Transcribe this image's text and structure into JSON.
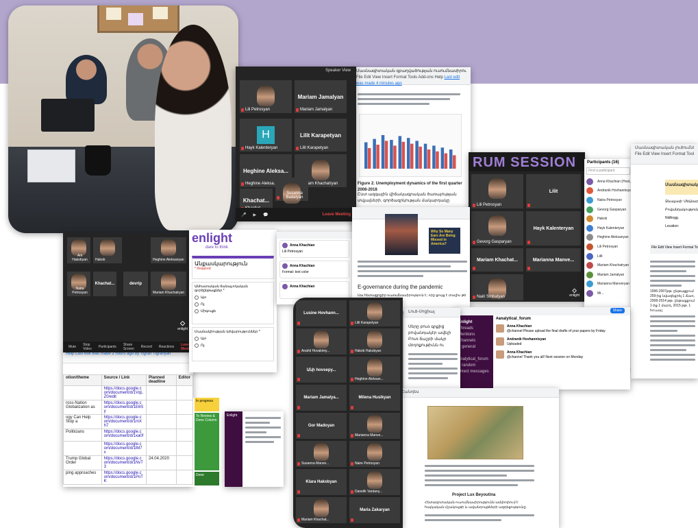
{
  "top_right_doc": {
    "title_line": "Մասնագիտական զբաղվածության ուսումնասիրություն",
    "menu": "File  Edit  View  Insert  Format  Tools  Add-ons  Help",
    "last_edit": "Last edit was made 4 minutes ago",
    "heading": "Figure 2. Unemployment dynamics of the first quarter 2008-2018",
    "body": "Ըստ ազգային վիճակագրական ծառայության տվյալների, գործազրկության մակարդակը"
  },
  "zoom_top": {
    "speaker_view": "Speaker View",
    "tiles": [
      {
        "name": "Lili Petrosyan",
        "type": "face"
      },
      {
        "name": "Mariam Jamalyan",
        "type": "name"
      },
      {
        "name": "Hayk Kalenteryan",
        "type": "letter",
        "letter": "H"
      },
      {
        "name": "Lilit Karapetyan",
        "type": "name"
      },
      {
        "name": "Heghine Aleksa...",
        "type": "name"
      },
      {
        "name": "Mariam Khachatryan",
        "type": "face"
      },
      {
        "name": "Khachat...",
        "type": "name"
      },
      {
        "name": "Susanna Badalyan",
        "type": "face"
      }
    ],
    "leave": "Leave Meeting"
  },
  "forum": {
    "title": "RUM SESSION",
    "tiles": [
      {
        "name": "Lili Petrosyan",
        "label": ""
      },
      {
        "name": "Lilit",
        "label": "Lilit"
      },
      {
        "name": "Gevorg Gasparyan",
        "label": ""
      },
      {
        "name": "Hayk Kalenteryan",
        "label": "Hayk Kalenteryan"
      },
      {
        "name": "Mariam Khachat...",
        "label": "Mariam Khachat..."
      },
      {
        "name": "Marianna Manve...",
        "label": "Marianna Manve..."
      },
      {
        "name": "Nairi Smbatyan",
        "label": ""
      }
    ],
    "brand": "enlight"
  },
  "participants": {
    "header": "Participants (16)",
    "search": "Find a participant",
    "names": [
      "Anna Khachian (Host, me)",
      "Andranik Hovhannisyan",
      "Naira Petrosyan",
      "Gevorg Gasparyan",
      "Hakob",
      "Hayk Kalenteryan",
      "Heghine Aleksanyan",
      "Lili Petrosyan",
      "Lilit",
      "Mariam Khachatryan",
      "Mariam Jamalyan",
      "Marianna Manveryan",
      "Mi..."
    ],
    "colors": [
      "#7b5aa6",
      "#e0583c",
      "#3d9cd2",
      "#46a35e",
      "#d08a2f",
      "#3d7fd2",
      "#8b8b8b",
      "#c6542f",
      "#4a66c2",
      "#c04949",
      "#5b8f3c",
      "#3d9cd2",
      "#7b5aa6"
    ]
  },
  "right_doc": {
    "title": "Մասնագիտական լուծումներ",
    "menu": "File  Edit  View  Insert  Format  Tools  Ad",
    "sub_title": "Մասնագիտական լուծումներ հայաստանում",
    "fields": [
      "Ձևաչափ: Մեկնարկ",
      "Բովանդակություն: Քննարկում",
      "Nidhogg.",
      "Location:"
    ],
    "menu2": "File  Edit  View  Insert  Format  Tools  Add-ons  Help  Last edit was made seconds ago",
    "body": "1996-2007թթ. ընթացքում 259-ից նվազեցրել 1 Ճառ, 2008-2014 թթ. ընթացքում 1-ից 1 մարդ, 2015 թթ. 1 հուսալ"
  },
  "zoom_left": {
    "tiles": [
      {
        "name": "Ani Hakobyan"
      },
      {
        "name": "Hakob"
      },
      {
        "name": "Heghine Aleksanyan"
      },
      {
        "name": "Naira Petrosyan"
      },
      {
        "name": "Khachat..."
      },
      {
        "name": "devrip"
      },
      {
        "name": "Mariam Khachatryan"
      }
    ],
    "brand": "enlight",
    "leave": "Leave Meeting",
    "toolbar": [
      "Mute",
      "Stop Video",
      "Participants",
      "Share Screen",
      "Record",
      "Reactions"
    ]
  },
  "form": {
    "brand": "enlight",
    "tagline": "dare to think",
    "title": "Անքասկարություն",
    "required": "* Required",
    "q1": "Անհատական ճանաչողական գործընթացներ *",
    "options": [
      "Այո",
      "Ոչ",
      "Միգուցե"
    ],
    "q2": "Մասնակիության դժվարություններ *",
    "options2": [
      "Այո",
      "Ոչ"
    ]
  },
  "sheet": {
    "menu_help": "Help   Last edit was made 2 hours ago by Tigran Tigranyan",
    "headers": [
      "otion/theme",
      "Source / Link",
      "Planned deadline",
      "Editor"
    ],
    "rows": [
      {
        "a": "",
        "b": "https://docs.google.com/document/d/1VqLZ0/edit",
        "c": "",
        "d": ""
      },
      {
        "a": "ross-Nation Globalization as",
        "b": "https://docs.google.com/document/d/1E6Sy",
        "c": "",
        "d": ""
      },
      {
        "a": "ogy Can Help Stop a",
        "b": "https://docs.google.com/document/d/1mXh7",
        "c": "",
        "d": ""
      },
      {
        "a": "Politicians",
        "b": "https://docs.google.com/document/d/1xa0f",
        "c": "",
        "d": ""
      },
      {
        "a": "",
        "b": "https://docs.google.com/document/d/1lM7x",
        "c": "",
        "d": ""
      },
      {
        "a": "Trump Global Order",
        "b": "https://docs.google.com/document/d/1NvT3",
        "c": "24.04.2020",
        "d": ""
      },
      {
        "a": "ping approaches",
        "b": "https://docs.google.com/document/d/1PoTK",
        "c": "",
        "d": ""
      }
    ],
    "kanban": [
      "In progress",
      "To Review & Done Column",
      "Done"
    ]
  },
  "comments": {
    "items": [
      {
        "name": "Anna Khachian",
        "text": "Lili Petrosyan"
      },
      {
        "name": "Anna Khachian",
        "text": "Format: text color"
      },
      {
        "name": "Anna Khachian",
        "text": ""
      }
    ]
  },
  "middle_doc": {
    "caption": "E-governance during the pandemic",
    "body": "Սա հետաքրքիր ուսումնասիրություն է, որը ցույց է տալիս թե ինչպես",
    "sticker": "Why So Many Ears Are Being Missed in America?"
  },
  "zoom_bottom": {
    "tiles": [
      {
        "name": "Lusine Hovhann...",
        "type": "name"
      },
      {
        "name": "Lilit Karapetyan",
        "type": "face"
      },
      {
        "name": "Anahit Hovakimy...",
        "type": "face"
      },
      {
        "name": "Hakob Hakobyan",
        "type": "face"
      },
      {
        "name": "Անի hovsepy...",
        "type": "name"
      },
      {
        "name": "Heghine Aleksan...",
        "type": "face"
      },
      {
        "name": "Mariam Jamalya...",
        "type": "name"
      },
      {
        "name": "Milena Husikyan",
        "type": "name"
      },
      {
        "name": "Gor Madoyan",
        "type": "name"
      },
      {
        "name": "Marianna Manve...",
        "type": "face"
      },
      {
        "name": "Susanna Manve...",
        "type": "face"
      },
      {
        "name": "Naire Petrosyan",
        "type": "face"
      },
      {
        "name": "",
        "type": "name",
        "label": "Klara Hakobyan"
      },
      {
        "name": "Danelik Vardany...",
        "type": "face"
      },
      {
        "name": "Mariam Khachat...",
        "type": "face"
      },
      {
        "name": "",
        "type": "name",
        "label": "Maria Zakaryan"
      }
    ]
  },
  "bottom_doc": {
    "title": "Հանդես",
    "heading": "Project Lux Beyoutina",
    "body": "Հետազոտական ուսումնասիրությունն ամփոփում է հայկական մշակույթի և ավանդույթների ազդեցությունը"
  },
  "small_doc": {
    "title": "Լուծ-Սոցիալ",
    "text_lines": [
      "Սերը բուռ գրքից",
      "բովանդակէր ավելի",
      "Բուռ ճաշբի մակր",
      "մօդոքութիւնն ու"
    ]
  },
  "slack": {
    "workspace": "Enlight",
    "channel": "#analytical_forum",
    "channels": [
      "Threads",
      "Mentions",
      "Channels",
      "# general",
      "# analytical_forum",
      "# random",
      "Direct messages"
    ],
    "msgs": [
      {
        "name": "Anna Khachian",
        "text": "@channel Please upload the final drafts of your papers by Friday"
      },
      {
        "name": "Andranik Hovhannisyan",
        "text": "Uploaded"
      },
      {
        "name": "Anna Khachian",
        "text": "@channel Thank you all! Next session on Monday"
      }
    ],
    "share": "Share"
  },
  "bottom_slack": {
    "workspace": "Enlight",
    "items": [
      "Threads",
      "# general",
      "# random"
    ]
  }
}
